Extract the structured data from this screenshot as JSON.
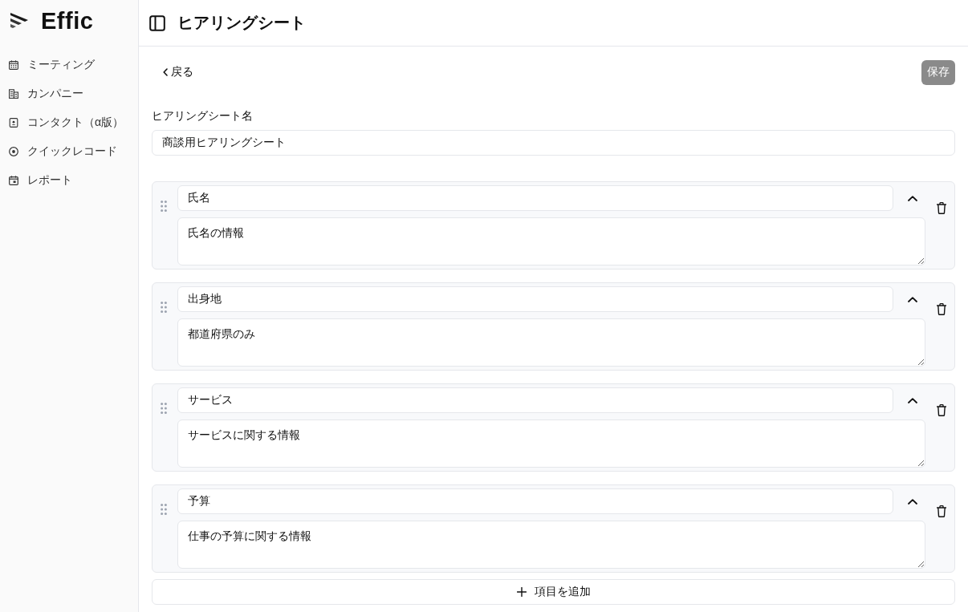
{
  "sidebar": {
    "logo": "Effic",
    "items": [
      {
        "label": "ミーティング",
        "selected": false
      },
      {
        "label": "カンパニー",
        "selected": false
      },
      {
        "label": "コンタクト（α版）",
        "selected": false
      },
      {
        "label": "クイックレコード",
        "selected": false
      },
      {
        "label": "レポート",
        "selected": false
      }
    ]
  },
  "header": {
    "title": "ヒアリングシート"
  },
  "toolbar": {
    "back": {
      "label": "戻る"
    },
    "save": {
      "label": "保存",
      "disabled": true
    }
  },
  "sheet_name": {
    "label": "ヒアリングシート名",
    "value": "商談用ヒアリングシート"
  },
  "items": [
    {
      "title": "氏名",
      "description": "氏名の情報",
      "expanded": true
    },
    {
      "title": "出身地",
      "description": "都道府県のみ",
      "expanded": true
    },
    {
      "title": "サービス",
      "description": "サービスに関する情報",
      "expanded": true
    },
    {
      "title": "予算",
      "description": "仕事の予算に関する情報",
      "expanded": true
    }
  ],
  "add_button": {
    "label": "項目を追加"
  }
}
